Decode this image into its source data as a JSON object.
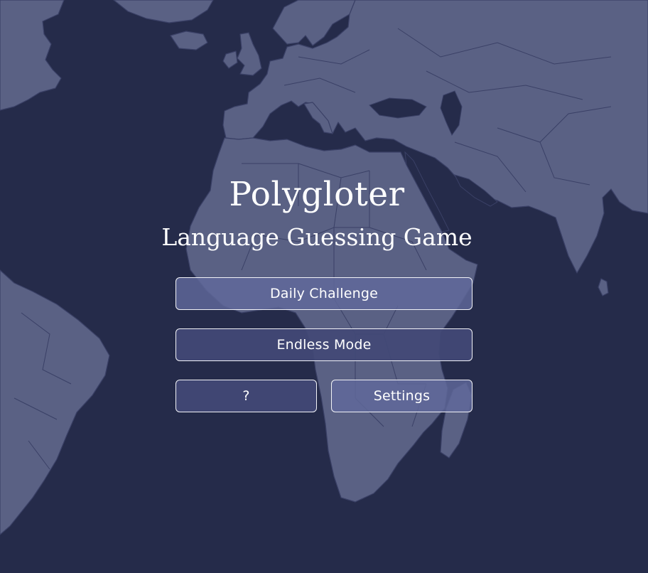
{
  "game": {
    "title": "Polygloter",
    "subtitle": "Language Guessing Game"
  },
  "menu": {
    "daily_label": "Daily Challenge",
    "endless_label": "Endless Mode",
    "help_label": "?",
    "settings_label": "Settings"
  },
  "theme": {
    "background": "#252b4a",
    "land": "#5a6184",
    "button_border": "#f2f3f8",
    "text": "#ffffff"
  }
}
